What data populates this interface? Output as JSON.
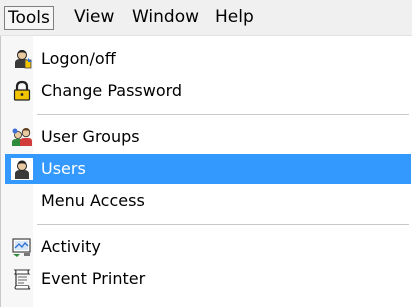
{
  "menubar": {
    "items": [
      {
        "label": "Tools",
        "active": true
      },
      {
        "label": "View"
      },
      {
        "label": "Window"
      },
      {
        "label": "Help"
      }
    ]
  },
  "dropdown": {
    "items": [
      {
        "label": "Logon/off",
        "icon": "logon-icon"
      },
      {
        "label": "Change Password",
        "icon": "padlock-icon"
      },
      {
        "label": "User Groups",
        "icon": "user-groups-icon"
      },
      {
        "label": "Users",
        "icon": "user-icon",
        "highlighted": true
      },
      {
        "label": "Menu Access"
      },
      {
        "label": "Activity",
        "icon": "activity-icon"
      },
      {
        "label": "Event Printer",
        "icon": "printer-icon"
      }
    ]
  },
  "colors": {
    "highlight": "#3399ff",
    "menubar_bg": "#f0f0f0",
    "padlock": "#f2c400"
  }
}
